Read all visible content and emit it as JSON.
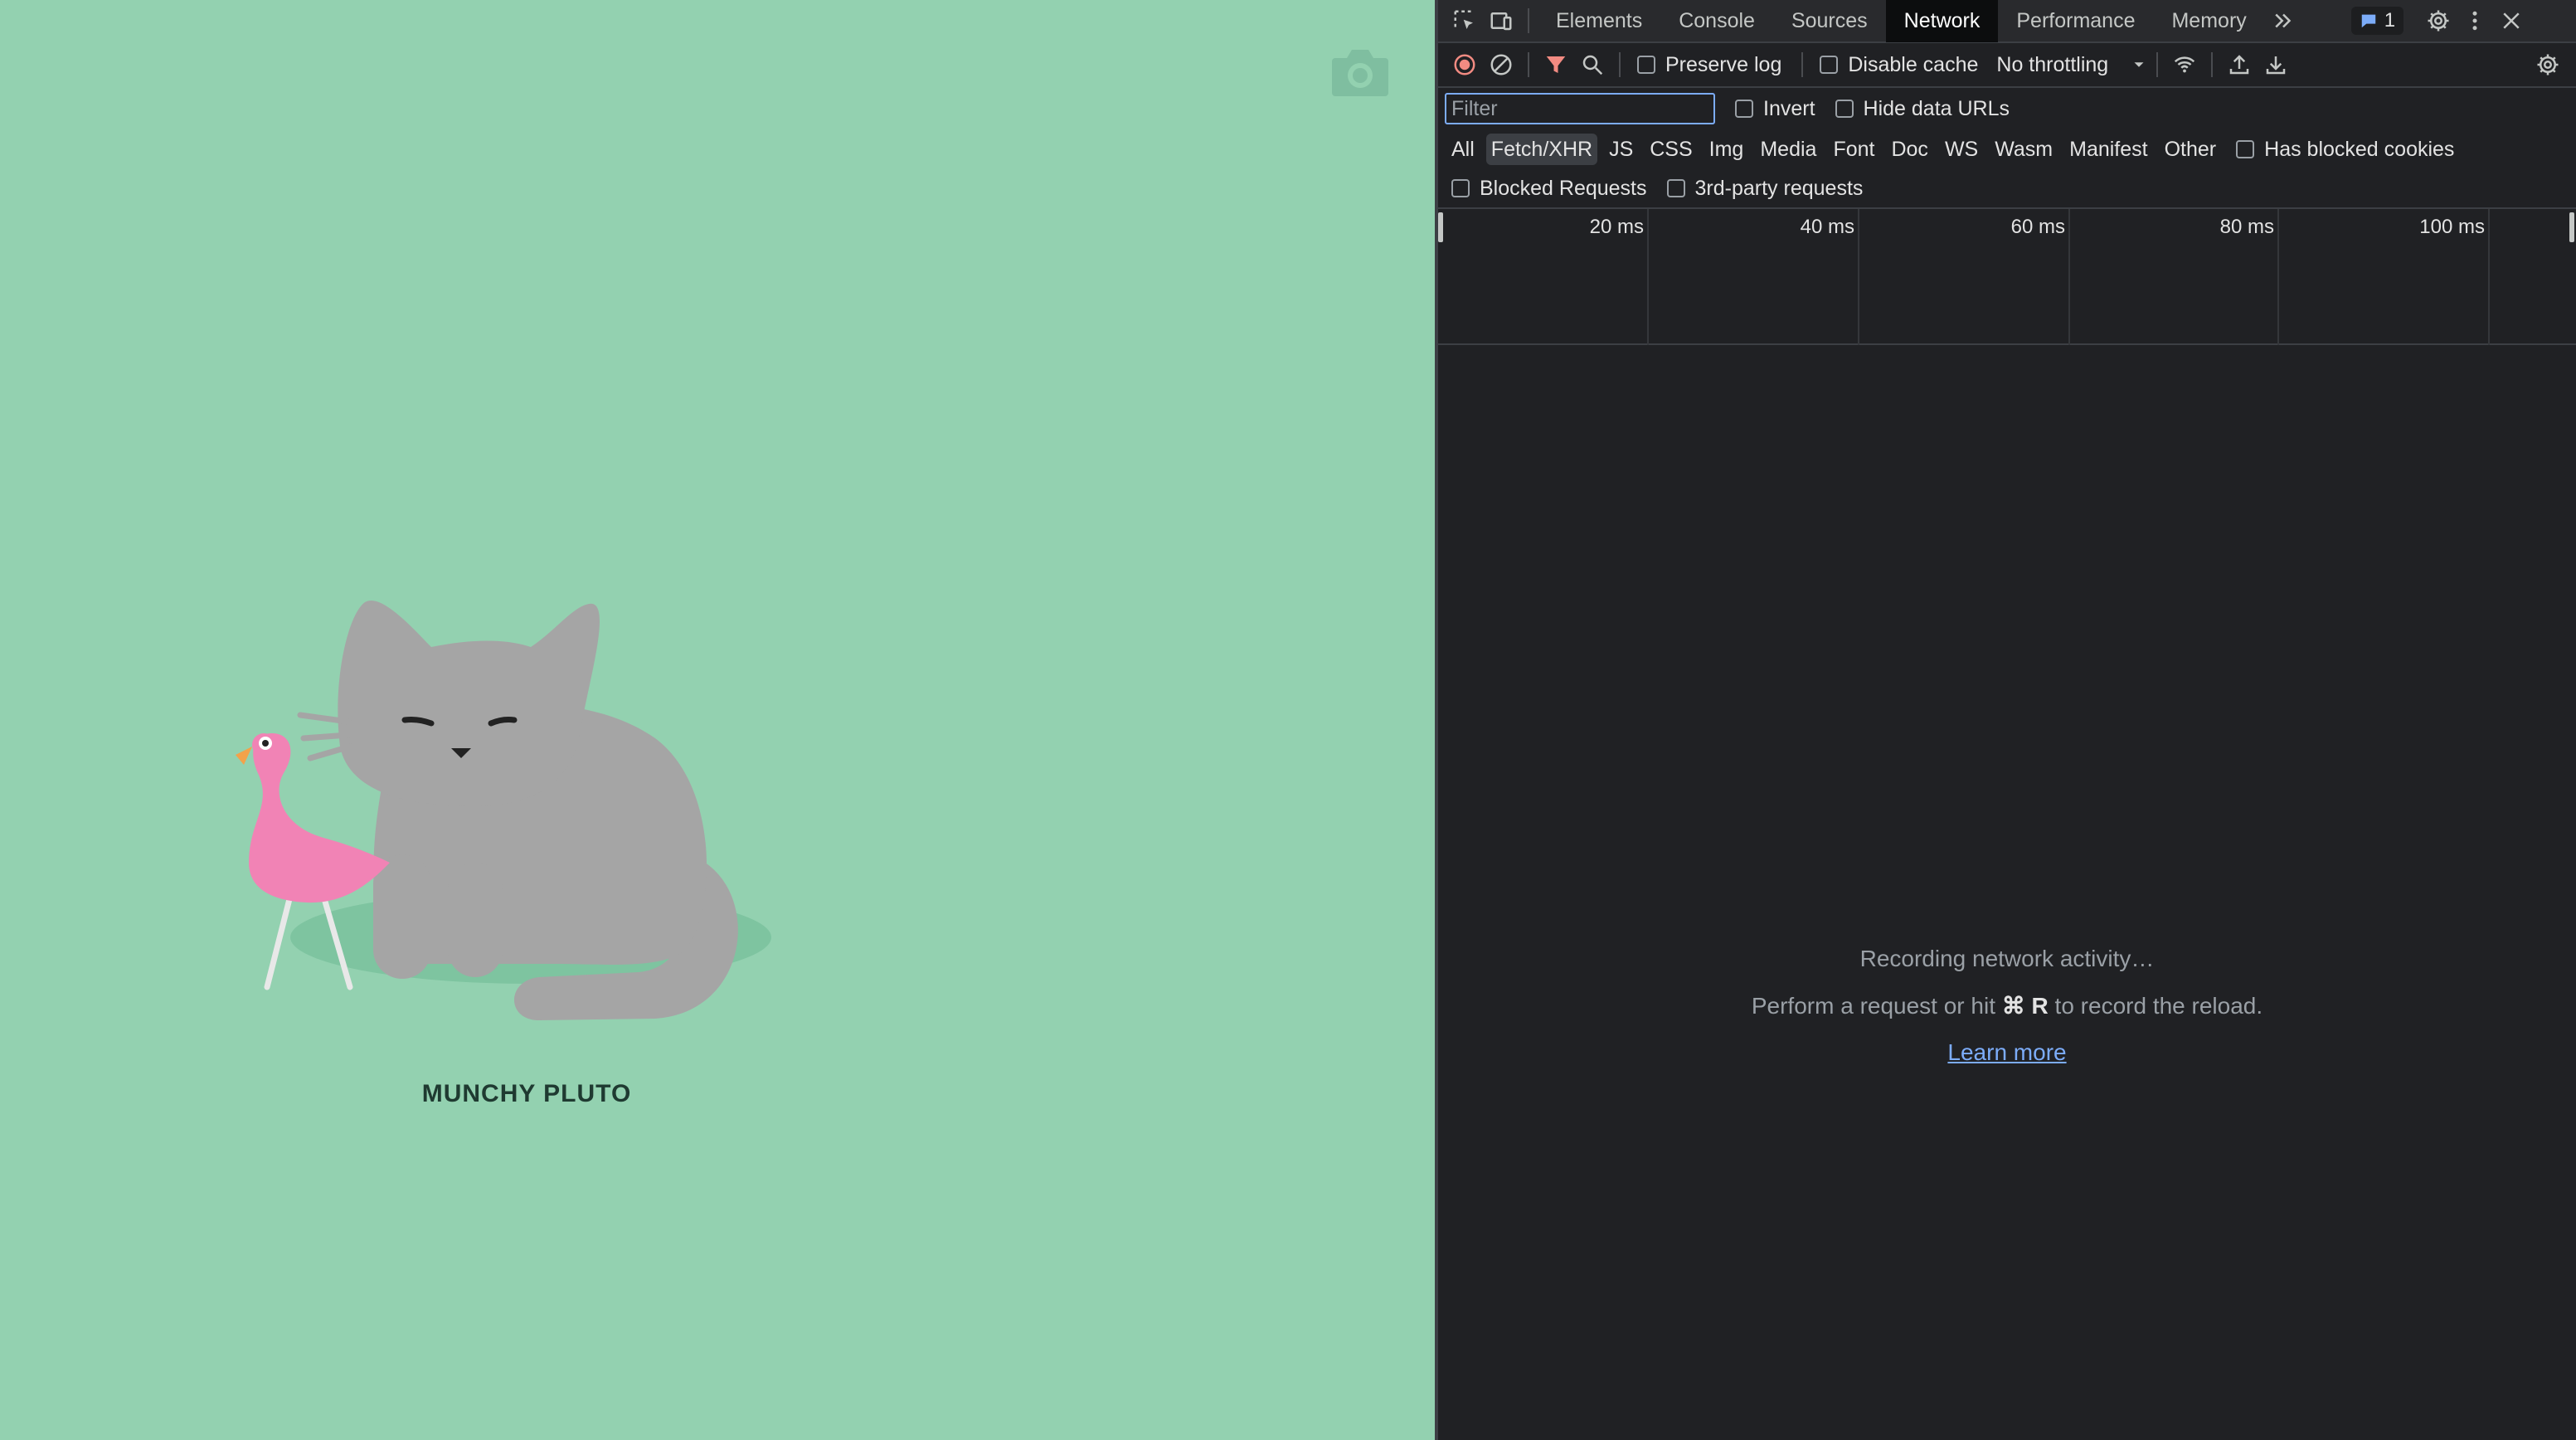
{
  "page": {
    "pet_name": "MUNCHY PLUTO",
    "background_color": "#93d1b0",
    "camera_icon": "camera-icon"
  },
  "devtools": {
    "tabs": [
      {
        "label": "Elements",
        "active": false
      },
      {
        "label": "Console",
        "active": false
      },
      {
        "label": "Sources",
        "active": false
      },
      {
        "label": "Network",
        "active": true
      },
      {
        "label": "Performance",
        "active": false
      },
      {
        "label": "Memory",
        "active": false
      }
    ],
    "issues_count": "1",
    "toolbar": {
      "preserve_log": "Preserve log",
      "disable_cache": "Disable cache",
      "throttling": "No throttling"
    },
    "filter": {
      "placeholder": "Filter",
      "invert": "Invert",
      "hide_data_urls": "Hide data URLs"
    },
    "types": [
      {
        "label": "All",
        "selected": false
      },
      {
        "label": "Fetch/XHR",
        "selected": true
      },
      {
        "label": "JS",
        "selected": false
      },
      {
        "label": "CSS",
        "selected": false
      },
      {
        "label": "Img",
        "selected": false
      },
      {
        "label": "Media",
        "selected": false
      },
      {
        "label": "Font",
        "selected": false
      },
      {
        "label": "Doc",
        "selected": false
      },
      {
        "label": "WS",
        "selected": false
      },
      {
        "label": "Wasm",
        "selected": false
      },
      {
        "label": "Manifest",
        "selected": false
      },
      {
        "label": "Other",
        "selected": false
      }
    ],
    "has_blocked_cookies": "Has blocked cookies",
    "blocked_requests": "Blocked Requests",
    "third_party_requests": "3rd-party requests",
    "timeline_ticks": [
      "20 ms",
      "40 ms",
      "60 ms",
      "80 ms",
      "100 ms"
    ],
    "empty_state": {
      "recording": "Recording network activity…",
      "hint_prefix": "Perform a request or hit ",
      "hint_shortcut": "⌘ R",
      "hint_suffix": " to record the reload.",
      "learn_more": "Learn more"
    },
    "accent_color": "#7cacf8",
    "record_color": "#f28b82"
  }
}
